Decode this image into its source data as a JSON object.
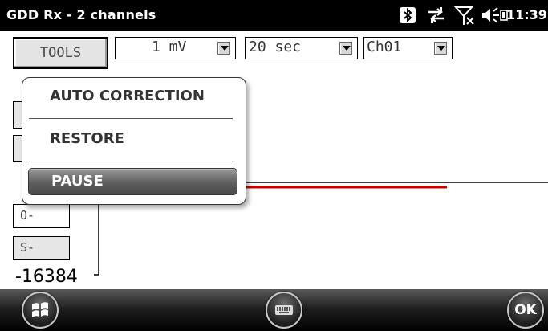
{
  "window": {
    "title": "GDD Rx - 2 channels",
    "clock": "11:39"
  },
  "status_icons": [
    "bluetooth-icon",
    "data-sync-icon",
    "signal-off-icon",
    "volume-icon",
    "battery-icon"
  ],
  "toolbar": {
    "tools_label": "TOOLS",
    "scale_value": "1 mV",
    "time_value": "20 sec",
    "channel_value": "Ch01"
  },
  "chart": {
    "y_min_label": "-16384",
    "offset_minus_label": "O-",
    "scale_minus_label": "S-",
    "trace_color": "#d40000"
  },
  "popup_menu": {
    "items": [
      {
        "label": "AUTO CORRECTION",
        "selected": false
      },
      {
        "label": "RESTORE",
        "selected": false
      },
      {
        "label": "PAUSE",
        "selected": true
      }
    ]
  },
  "softkeys": {
    "start_icon": "windows-start-icon",
    "keyboard_icon": "keyboard-icon",
    "ok_label": "OK"
  }
}
